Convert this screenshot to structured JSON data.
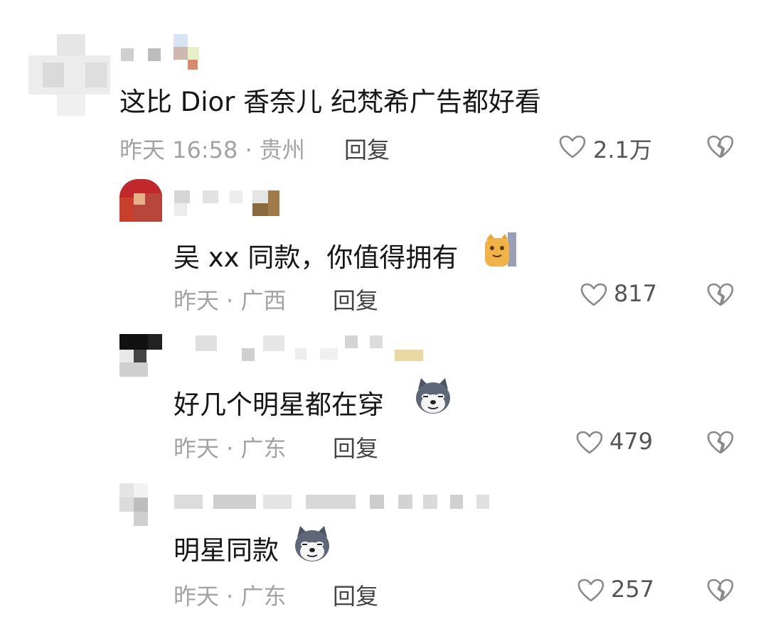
{
  "comments": [
    {
      "text": "这比 Dior 香奈儿 纪梵希广告都好看",
      "meta": "昨天 16:58 · 贵州",
      "reply_label": "回复",
      "likes": "2.1万"
    },
    {
      "text": "吴 xx 同款，你值得拥有",
      "meta": "昨天 · 广西",
      "reply_label": "回复",
      "likes": "817",
      "emoji": "cat-emoji"
    },
    {
      "text": "好几个明星都在穿",
      "meta": "昨天 · 广东",
      "reply_label": "回复",
      "likes": "479",
      "emoji": "husky-emoji"
    },
    {
      "text": "明星同款",
      "meta": "昨天 · 广东",
      "reply_label": "回复",
      "likes": "257",
      "emoji": "husky-emoji"
    }
  ],
  "icons": {
    "like": "heart-icon",
    "dislike": "broken-heart-icon"
  },
  "colors": {
    "text": "#161616",
    "meta": "#a3a3a3",
    "icon": "#8a8a8a"
  }
}
